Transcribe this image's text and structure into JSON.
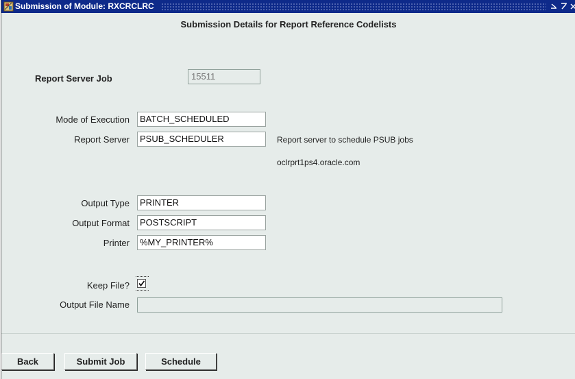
{
  "window": {
    "title": "Submission of Module: RXCRCLRC",
    "controls": [
      "⌄",
      "⁄",
      "×"
    ]
  },
  "heading": "Submission Details for Report Reference Codelists",
  "report_server_job": {
    "label": "Report Server Job",
    "value": "15511"
  },
  "mode_of_execution": {
    "label": "Mode of Execution",
    "value": "BATCH_SCHEDULED"
  },
  "report_server": {
    "label": "Report Server",
    "value": "PSUB_SCHEDULER",
    "description": "Report server to schedule PSUB jobs",
    "host": "oclrprt1ps4.oracle.com"
  },
  "output_type": {
    "label": "Output Type",
    "value": "PRINTER"
  },
  "output_format": {
    "label": "Output Format",
    "value": "POSTSCRIPT"
  },
  "printer": {
    "label": "Printer",
    "value": "%MY_PRINTER%"
  },
  "keep_file": {
    "label": "Keep File?",
    "checked": true
  },
  "output_file_name": {
    "label": "Output File Name",
    "value": ""
  },
  "buttons": {
    "back": "Back",
    "submit_job": "Submit Job",
    "schedule": "Schedule"
  },
  "colors": {
    "titlebar": "#0e2a8a",
    "background": "#e6ecea"
  }
}
